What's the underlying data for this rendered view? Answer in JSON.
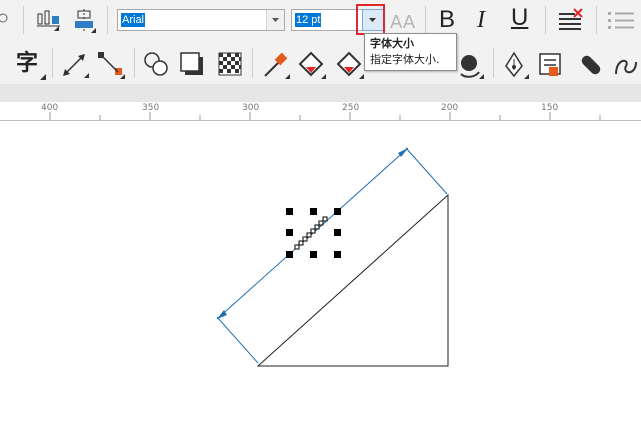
{
  "toolbar": {
    "font_family": "Arial",
    "font_size": "12 pt",
    "font_size_dropdown_icon": "chevron-down-icon",
    "font_scale_icon": "AA",
    "bold_label": "B",
    "italic_label": "I",
    "underline_label": "U",
    "character_tool_label": "字"
  },
  "tooltip": {
    "title": "字体大小",
    "description": "指定字体大小."
  },
  "ruler": {
    "ticks": [
      "400",
      "350",
      "300",
      "250",
      "200",
      "150"
    ]
  },
  "colors": {
    "accent_blue": "#0078d7",
    "dimension_line": "#1f6fb5",
    "highlight_red": "#e0282a",
    "toolbar_bg": "#f2f2f2"
  }
}
